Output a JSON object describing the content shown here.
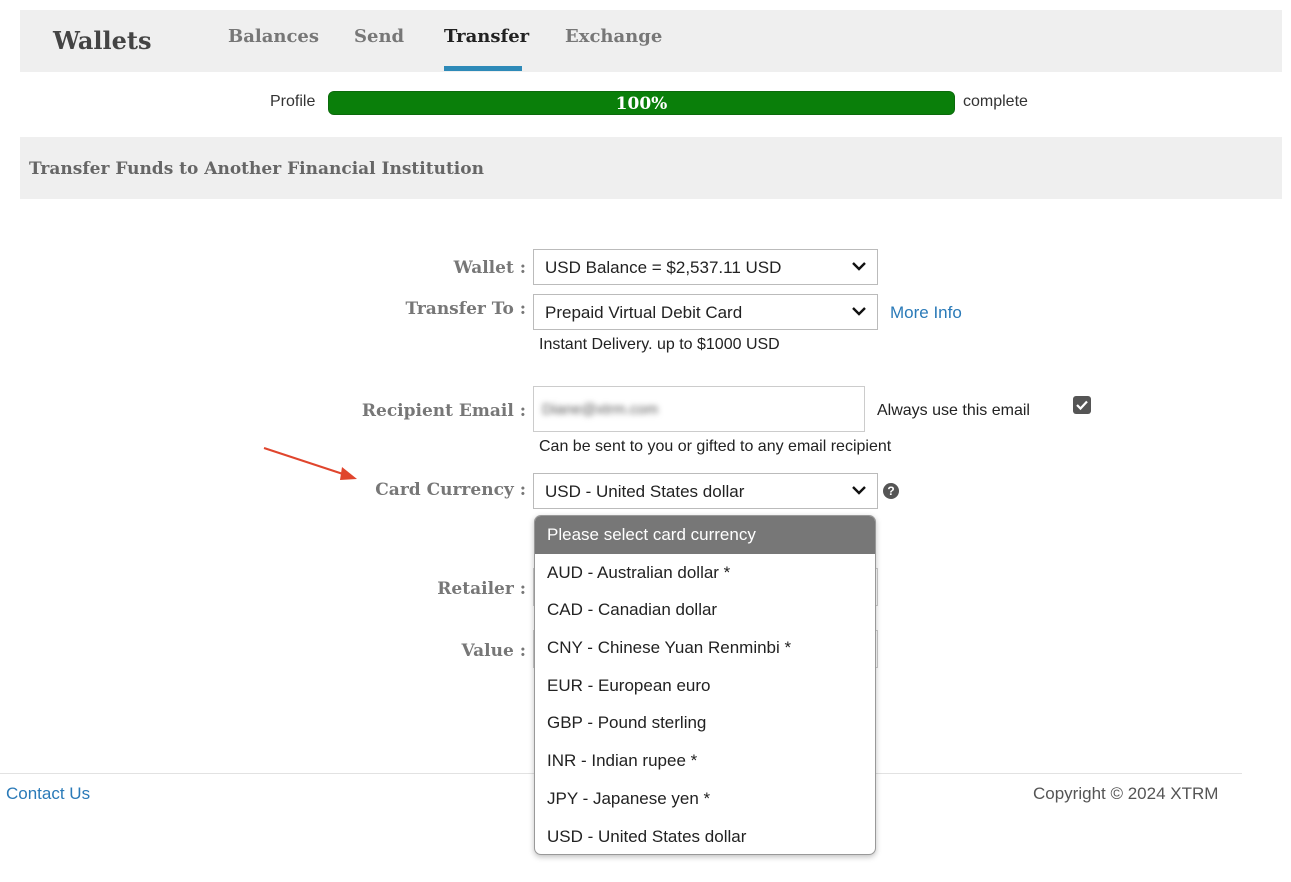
{
  "nav": {
    "brand": "Wallets",
    "tabs": [
      {
        "label": "Balances"
      },
      {
        "label": "Send"
      },
      {
        "label": "Transfer"
      },
      {
        "label": "Exchange"
      }
    ]
  },
  "profile": {
    "label": "Profile",
    "percent_text": "100%",
    "percent": 100,
    "complete_label": "complete"
  },
  "section": {
    "title": "Transfer Funds to Another Financial Institution"
  },
  "form": {
    "wallet_label": "Wallet :",
    "wallet_value": "USD Balance = $2,537.11 USD",
    "transfer_label": "Transfer To :",
    "transfer_value": "Prepaid Virtual Debit Card",
    "more_info": "More Info",
    "transfer_note": "Instant Delivery. up to $1000 USD",
    "email_label": "Recipient Email :",
    "email_value": "Diane@xtrm.com",
    "always_use": "Always use this email",
    "always_use_checked": true,
    "email_note": "Can be sent to you or gifted to any email recipient",
    "currency_label": "Card Currency :",
    "currency_value": "USD - United States dollar",
    "retailer_label": "Retailer :",
    "value_label": "Value :"
  },
  "dropdown": {
    "options": [
      "Please select card currency",
      "AUD - Australian dollar *",
      "CAD - Canadian dollar",
      "CNY - Chinese Yuan Renminbi *",
      "EUR - European euro",
      "GBP - Pound sterling",
      "INR - Indian rupee *",
      "JPY - Japanese yen *",
      "USD - United States dollar"
    ],
    "highlighted_index": 0
  },
  "footer": {
    "contact": "Contact Us",
    "copyright": "Copyright © 2024 XTRM"
  },
  "colors": {
    "accent": "#2e8ab8",
    "progress": "#0a7f0a",
    "arrow": "#e0452d"
  }
}
